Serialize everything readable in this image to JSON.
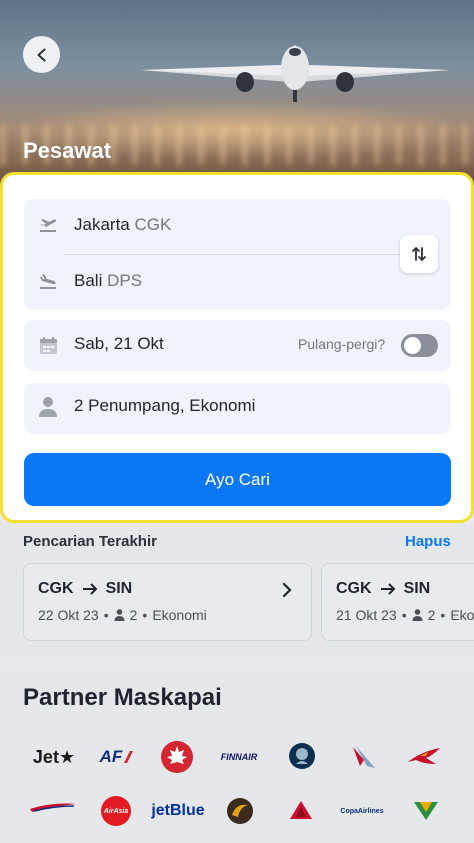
{
  "header": {
    "title": "Pesawat"
  },
  "search": {
    "origin_city": "Jakarta",
    "origin_code": "CGK",
    "destination_city": "Bali",
    "destination_code": "DPS",
    "date": "Sab, 21 Okt",
    "round_trip_label": "Pulang-pergi?",
    "round_trip_enabled": false,
    "passengers": "2 Penumpang, Ekonomi",
    "submit_label": "Ayo Cari"
  },
  "recent": {
    "title": "Pencarian Terakhir",
    "clear_label": "Hapus",
    "items": [
      {
        "from": "CGK",
        "to": "SIN",
        "date": "22 Okt 23",
        "pax": "2",
        "cabin": "Ekonomi"
      },
      {
        "from": "CGK",
        "to": "SIN",
        "date": "21 Okt 23",
        "pax": "2",
        "cabin": "Ekonomi"
      }
    ]
  },
  "partners": {
    "title": "Partner Maskapai",
    "logos": [
      {
        "text": "Jet★",
        "icon": "jetstar-logo",
        "color": "#1a1a1a"
      },
      {
        "text": "AF",
        "icon": "air-france-logo",
        "color": "#0b2d7c"
      },
      {
        "text": "",
        "icon": "air-canada-logo",
        "color": "#d22630"
      },
      {
        "text": "FINNAIR",
        "icon": "finnair-logo",
        "color": "#0b1560"
      },
      {
        "text": "",
        "icon": "alaska-airlines-logo",
        "color": "#0d2f4f"
      },
      {
        "text": "",
        "icon": "american-airlines-logo",
        "color": "#c8102e"
      },
      {
        "text": "",
        "icon": "air-india-logo",
        "color": "#c8102e"
      },
      {
        "text": "",
        "icon": "british-airways-logo",
        "color": "#c8102e"
      },
      {
        "text": "AirAsia",
        "icon": "airasia-logo",
        "color": "#e21b23"
      },
      {
        "text": "jetBlue",
        "icon": "jetblue-logo",
        "color": "#0033a0"
      },
      {
        "text": "",
        "icon": "garuda-logo",
        "color": "#3b2a1e"
      },
      {
        "text": "",
        "icon": "delta-logo",
        "color": "#c8102e"
      },
      {
        "text": "CopaAirlines",
        "icon": "copa-airlines-logo",
        "color": "#0b2d7c"
      },
      {
        "text": "",
        "icon": "eva-air-logo",
        "color": "#2a8f3e"
      }
    ]
  },
  "colors": {
    "accent": "#0a78f5",
    "highlight": "#f2e030"
  }
}
